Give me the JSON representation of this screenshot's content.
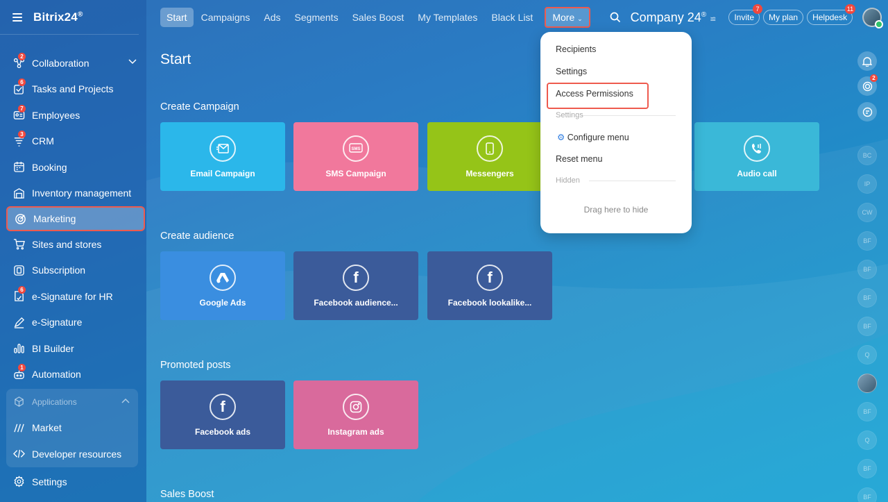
{
  "app": {
    "title": "Bitrix24",
    "mark": "®"
  },
  "sidebar": {
    "items": [
      {
        "label": "Collaboration",
        "badge": "2"
      },
      {
        "label": "Tasks and Projects",
        "badge": "6"
      },
      {
        "label": "Employees",
        "badge": "7"
      },
      {
        "label": "CRM",
        "badge": "3"
      },
      {
        "label": "Booking",
        "badge": ""
      },
      {
        "label": "Inventory management",
        "badge": ""
      },
      {
        "label": "Marketing",
        "badge": ""
      },
      {
        "label": "Sites and stores",
        "badge": ""
      },
      {
        "label": "Subscription",
        "badge": ""
      },
      {
        "label": "e-Signature for HR",
        "badge": "6"
      },
      {
        "label": "e-Signature",
        "badge": ""
      },
      {
        "label": "BI Builder",
        "badge": ""
      },
      {
        "label": "Automation",
        "badge": "1"
      }
    ],
    "applications": {
      "label": "Applications",
      "items": [
        {
          "label": "Market"
        },
        {
          "label": "Developer resources"
        }
      ]
    },
    "settings": "Settings"
  },
  "topbar": {
    "tabs": [
      "Start",
      "Campaigns",
      "Ads",
      "Segments",
      "Sales Boost",
      "My Templates",
      "Black List"
    ],
    "more": "More",
    "company": "Company 24",
    "company_mark": "®",
    "invite": {
      "label": "Invite",
      "badge": "7"
    },
    "myplan": "My plan",
    "helpdesk": {
      "label": "Helpdesk",
      "badge": "11"
    }
  },
  "main": {
    "title": "Start",
    "create_campaign": {
      "title": "Create Campaign",
      "cards": [
        {
          "label": "Email Campaign",
          "color": "#2bb7ea"
        },
        {
          "label": "SMS Campaign",
          "color": "#f1789c"
        },
        {
          "label": "Messengers",
          "color": "#95c418"
        },
        {
          "label": "Audio call",
          "color": "#3ab8d8"
        }
      ]
    },
    "create_audience": {
      "title": "Create audience",
      "cards": [
        {
          "label": "Google Ads",
          "color": "#3a8ee0"
        },
        {
          "label": "Facebook audience...",
          "color": "#3b5b9a"
        },
        {
          "label": "Facebook lookalike...",
          "color": "#3b5b9a"
        }
      ]
    },
    "promoted_posts": {
      "title": "Promoted posts",
      "cards": [
        {
          "label": "Facebook ads",
          "color": "#3b5b9a"
        },
        {
          "label": "Instagram ads",
          "color": "#d96a9c"
        }
      ]
    },
    "sales_boost": {
      "title": "Sales Boost"
    }
  },
  "dropdown": {
    "items": [
      "Recipients",
      "Settings",
      "Access Permissions"
    ],
    "settings_section": "Settings",
    "configure": "Configure menu",
    "reset": "Reset menu",
    "hidden_section": "Hidden",
    "drag_hint": "Drag here to hide"
  },
  "rail": {
    "notifications_badge": "2",
    "placeholders": [
      "BC",
      "IP",
      "CW",
      "BF",
      "BF",
      "BF",
      "BF",
      "Q",
      "BF",
      "Q",
      "BF",
      "BF"
    ]
  },
  "colors": {
    "highlight": "#ee5a4e",
    "badge": "#f0483e"
  }
}
